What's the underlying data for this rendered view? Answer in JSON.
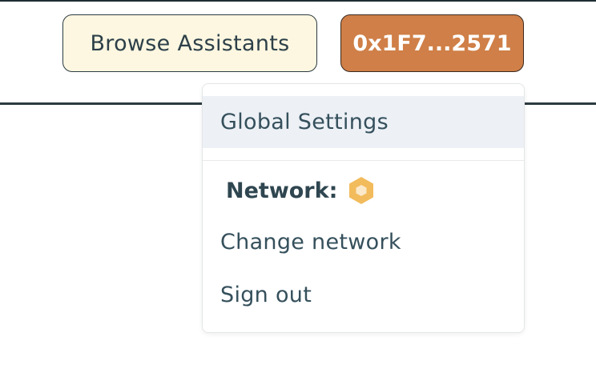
{
  "header": {
    "browse_label": "Browse Assistants",
    "wallet_label": "0x1F7...2571"
  },
  "dropdown": {
    "global_settings_label": "Global Settings",
    "network_label": "Network:",
    "network_icon": "hexagon-network-icon",
    "change_network_label": "Change network",
    "sign_out_label": "Sign out"
  },
  "colors": {
    "browse_bg": "#fdf7e1",
    "wallet_bg": "#cf7f47",
    "text_primary": "#35505c",
    "highlight_bg": "#edf1f6",
    "network_icon": "#f2bb5c"
  }
}
